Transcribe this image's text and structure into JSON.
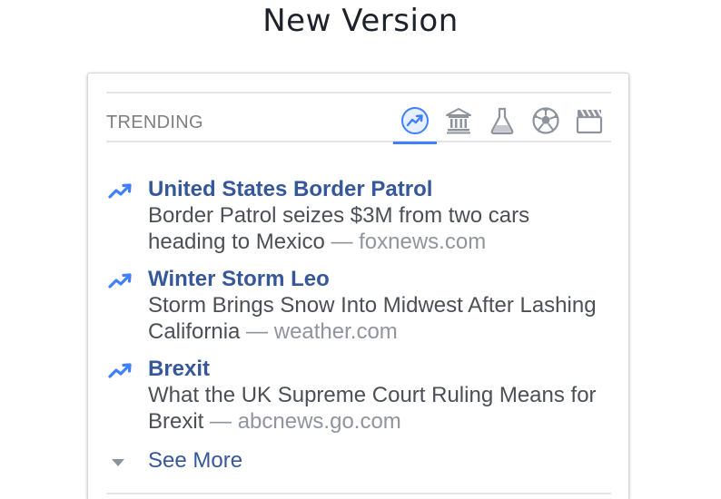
{
  "page": {
    "heading": "New Version"
  },
  "trending": {
    "label": "TRENDING",
    "categories": [
      {
        "icon": "trending-chart-icon",
        "label": "Top Trends",
        "active": true
      },
      {
        "icon": "bank-icon",
        "label": "Politics",
        "active": false
      },
      {
        "icon": "flask-icon",
        "label": "Science and Technology",
        "active": false
      },
      {
        "icon": "soccer-ball-icon",
        "label": "Sports",
        "active": false
      },
      {
        "icon": "clapperboard-icon",
        "label": "Entertainment",
        "active": false
      }
    ],
    "items": [
      {
        "title": "United States Border Patrol",
        "description": "Border Patrol seizes $3M from two cars heading to Mexico",
        "separator": " — ",
        "source": "foxnews.com"
      },
      {
        "title": "Winter Storm Leo",
        "description": "Storm Brings Snow Into Midwest After Lashing California",
        "separator": " — ",
        "source": "weather.com"
      },
      {
        "title": "Brexit",
        "description": "What the UK Supreme Court Ruling Means for Brexit",
        "separator": " — ",
        "source": "abcnews.go.com"
      }
    ],
    "see_more": "See More"
  },
  "colors": {
    "link": "#365899",
    "accent": "#4080ff",
    "body_text": "#4b4f56",
    "muted": "#90949c",
    "icon_gray": "#8d949e"
  }
}
